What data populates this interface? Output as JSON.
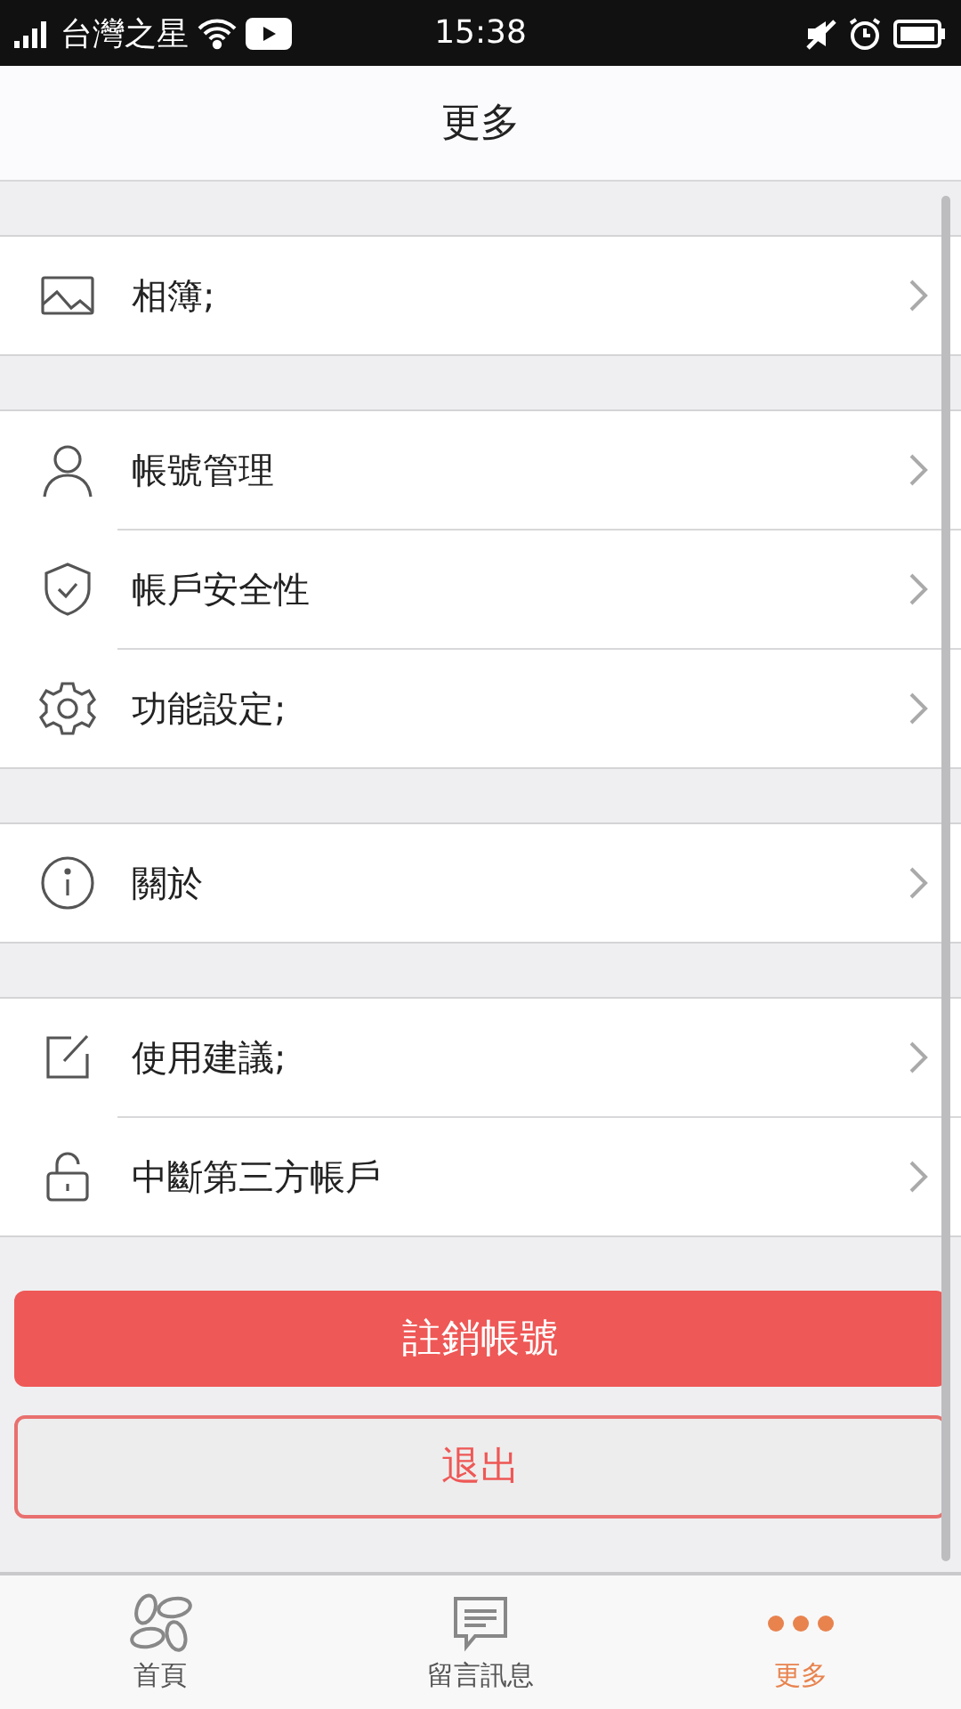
{
  "status_bar": {
    "carrier": "台灣之星",
    "time": "15:38"
  },
  "header": {
    "title": "更多"
  },
  "groups": [
    {
      "items": [
        {
          "kind": "image",
          "label": "相簿;"
        }
      ]
    },
    {
      "items": [
        {
          "kind": "person",
          "label": "帳號管理"
        },
        {
          "kind": "shield",
          "label": "帳戶安全性"
        },
        {
          "kind": "gear",
          "label": "功能設定;"
        }
      ]
    },
    {
      "items": [
        {
          "kind": "info",
          "label": "關於"
        }
      ]
    },
    {
      "items": [
        {
          "kind": "edit",
          "label": "使用建議;"
        },
        {
          "kind": "lock",
          "label": "中斷第三方帳戶"
        }
      ]
    }
  ],
  "buttons": [
    {
      "kind": "primary",
      "label": "註銷帳號"
    },
    {
      "kind": "outline",
      "label": "退出"
    }
  ],
  "tabs": [
    {
      "kind": "petals",
      "label": "首頁",
      "selected": false
    },
    {
      "kind": "message",
      "label": "留言訊息",
      "selected": false
    },
    {
      "kind": "dots",
      "label": "更多",
      "selected": true
    }
  ]
}
